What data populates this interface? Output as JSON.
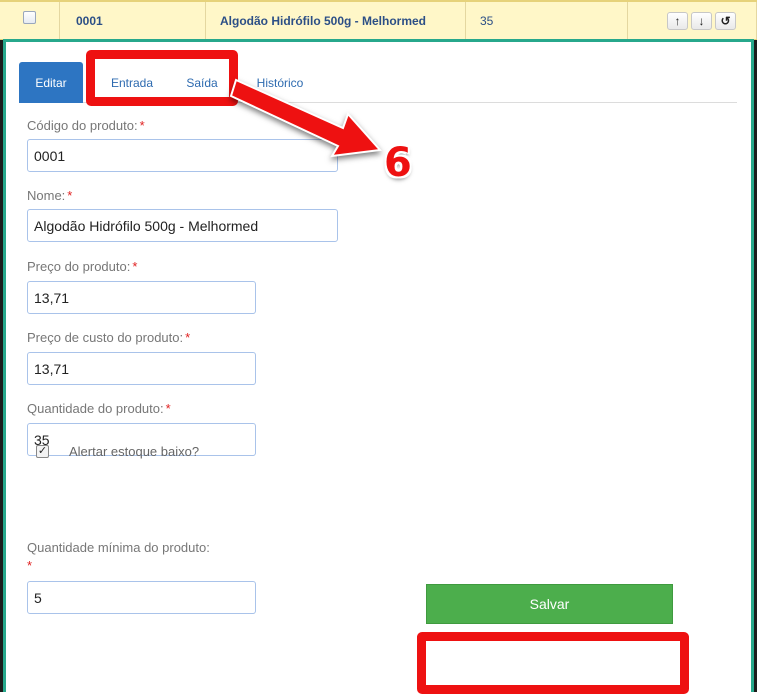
{
  "table_row": {
    "code": "0001",
    "name": "Algodão Hidrófilo 500g - Melhormed",
    "quantity": "35",
    "actions": [
      {
        "icon": "arrow-up-icon",
        "glyph": "↑"
      },
      {
        "icon": "arrow-down-icon",
        "glyph": "↓"
      },
      {
        "icon": "undo-icon",
        "glyph": "↺"
      }
    ]
  },
  "tabs": [
    {
      "label": "Editar",
      "active": true
    },
    {
      "label": "Entrada",
      "active": false
    },
    {
      "label": "Saída",
      "active": false
    },
    {
      "label": "Histórico",
      "active": false
    }
  ],
  "form": {
    "code_label": "Código do produto:",
    "code_value": "0001",
    "name_label": "Nome:",
    "name_value": "Algodão Hidrófilo 500g - Melhormed",
    "price_label": "Preço do produto:",
    "price_value": "13,71",
    "cost_label": "Preço de custo do produto:",
    "cost_value": "13,71",
    "qty_label": "Quantidade do produto:",
    "qty_value": "35",
    "alert_label": "Alertar estoque baixo?",
    "alert_checked": true,
    "min_qty_label": "Quantidade mínima do produto:",
    "min_qty_value": "5",
    "required_mark": "*",
    "save_label": "Salvar"
  },
  "annotation": {
    "step_number": "6",
    "color": "#ee1111"
  },
  "colors": {
    "active_tab": "#2d75c2",
    "save_button": "#4cae4c",
    "panel_border": "#27a88c",
    "row_highlight": "#fff7c8"
  }
}
